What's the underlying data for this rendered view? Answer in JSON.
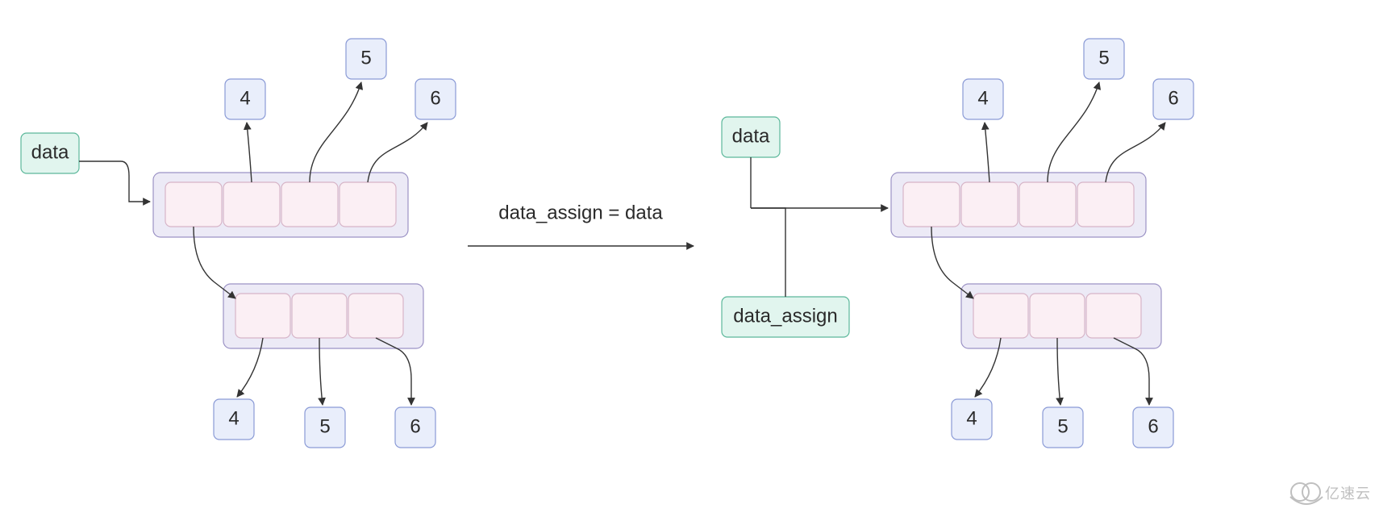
{
  "diagram": {
    "caption": "data_assign = data",
    "watermark": "亿速云",
    "left": {
      "data_label": "data",
      "top_values": [
        "4",
        "5",
        "6"
      ],
      "bottom_values": [
        "4",
        "5",
        "6"
      ]
    },
    "right": {
      "data_label": "data",
      "data_assign_label": "data_assign",
      "top_values": [
        "4",
        "5",
        "6"
      ],
      "bottom_values": [
        "4",
        "5",
        "6"
      ]
    },
    "colors": {
      "green_fill": "#e1f5ee",
      "green_stroke": "#5cb89b",
      "blue_fill": "#e9eefb",
      "blue_stroke": "#8a9ad6",
      "container_fill": "#eceaf6",
      "container_stroke": "#9b92c5",
      "inner_fill": "#fbeff4",
      "inner_stroke": "#d7b5c8"
    }
  }
}
